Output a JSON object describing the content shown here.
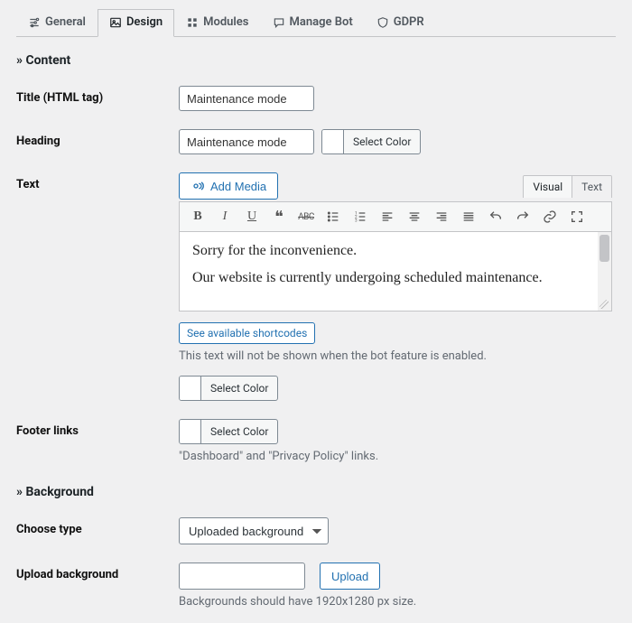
{
  "tabs": {
    "general": "General",
    "design": "Design",
    "modules": "Modules",
    "manage_bot": "Manage Bot",
    "gdpr": "GDPR"
  },
  "sections": {
    "content": "» Content",
    "background": "» Background"
  },
  "labels": {
    "title_html_tag": "Title (HTML tag)",
    "heading": "Heading",
    "text": "Text",
    "footer_links": "Footer links",
    "choose_type": "Choose type",
    "upload_background": "Upload background"
  },
  "values": {
    "title_html_tag": "Maintenance mode",
    "heading": "Maintenance mode",
    "editor_line1": "Sorry for the inconvenience.",
    "editor_line2": "Our website is currently undergoing scheduled maintenance.",
    "bg_type_selected": "Uploaded background",
    "upload_path": ""
  },
  "buttons": {
    "select_color": "Select Color",
    "add_media": "Add Media",
    "see_shortcodes": "See available shortcodes",
    "upload": "Upload"
  },
  "editor_tabs": {
    "visual": "Visual",
    "text": "Text"
  },
  "desc": {
    "text_hint": "This text will not be shown when the bot feature is enabled.",
    "footer_hint": "\"Dashboard\" and \"Privacy Policy\" links.",
    "bg_hint": "Backgrounds should have 1920x1280 px size."
  }
}
